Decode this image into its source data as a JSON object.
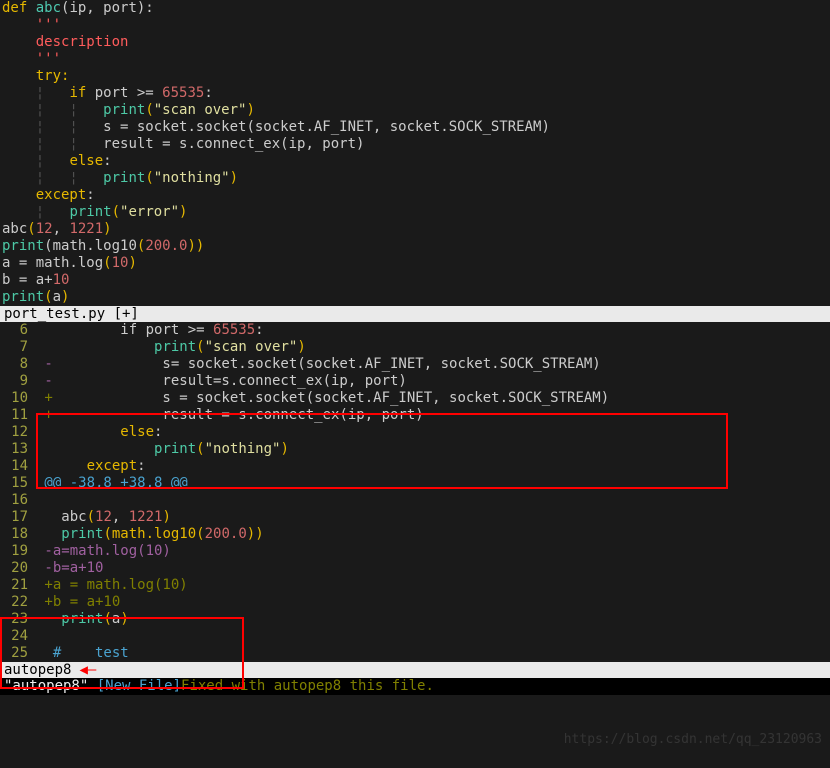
{
  "top": {
    "l1": {
      "def": "def ",
      "name": "abc",
      "args": "(ip, port):"
    },
    "l2": "    '''",
    "l3": "    description",
    "l4": "    '''",
    "l5": {
      "try": "    try:"
    },
    "l6": {
      "g": "    ¦   ",
      "if": "if ",
      "cond": "port >= ",
      "num": "65535",
      ":": ":"
    },
    "l7": {
      "g": "    ¦   ¦   ",
      "p": "print",
      "o": "(",
      "s": "\"scan over\"",
      "c": ")"
    },
    "l8": {
      "g": "    ¦   ¦   ",
      "code": "s = socket.socket(socket.AF_INET, socket.SOCK_STREAM)"
    },
    "l9": {
      "g": "    ¦   ¦   ",
      "code": "result = s.connect_ex(ip, port)"
    },
    "l10": {
      "g": "    ¦   ",
      "else": "else",
      ":": ":"
    },
    "l11": {
      "g": "    ¦   ¦   ",
      "p": "print",
      "o": "(",
      "s": "\"nothing\"",
      "c": ")"
    },
    "l12": {
      "except": "    except",
      ":": ":"
    },
    "l13": {
      "g": "    ¦   ",
      "p": "print",
      "o": "(",
      "s": "\"error\"",
      "c": ")"
    },
    "l14": "",
    "l15": "",
    "l16": {
      "fn": "abc",
      "o": "(",
      "a": "12",
      ",": ", ",
      "b": "1221",
      "c": ")"
    },
    "l17": {
      "p": "print",
      "o": "(math.log10",
      "paren": "(",
      "n": "200.0",
      "c": "))"
    },
    "l18": {
      "lhs": "a = math.log",
      "o": "(",
      "n": "10",
      "c": ")"
    },
    "l19": {
      "lhs": "b = a+",
      "n": "10"
    },
    "l20": {
      "p": "print",
      "o": "(",
      "a": "a",
      "c": ")"
    }
  },
  "status1": "port_test.py [+]",
  "bottom": {
    "lines": [
      {
        "num": "6",
        "text_pre": "         if",
        "text2": " port >= ",
        "num2": "65535",
        "colon": ":"
      },
      {
        "num": "7",
        "text_pre": "             ",
        "p": "print",
        "o": "(",
        "s": "\"scan over\"",
        "c": ")"
      },
      {
        "num": "8",
        "diff": "-",
        "text": "             s= socket.socket(socket.AF_INET, socket.SOCK_STREAM)"
      },
      {
        "num": "9",
        "diff": "-",
        "text": "             result=s.connect_ex(ip, port)"
      },
      {
        "num": "10",
        "diff": "+",
        "text": "             s = socket.socket(socket.AF_INET, socket.SOCK_STREAM)"
      },
      {
        "num": "11",
        "diff": "+",
        "text": "             result = s.connect_ex(ip, port)"
      },
      {
        "num": "12",
        "text_pre": "         ",
        "else": "else",
        ":": ":"
      },
      {
        "num": "13",
        "text_pre": "             ",
        "p": "print",
        "o": "(",
        "s": "\"nothing\"",
        "c": ")"
      },
      {
        "num": "14",
        "text_pre": "     ",
        "except": "except",
        ":": ":"
      },
      {
        "num": "15",
        "meta": " @@ -38,8 +38,8 @@"
      },
      {
        "num": "16",
        "blank": " "
      },
      {
        "num": "17",
        "text_pre": "  ",
        "fn": "abc",
        "o": "(",
        "a": "12",
        ",": ", ",
        "b": "1221",
        "c": ")"
      },
      {
        "num": "18",
        "text_pre": "  ",
        "p": "print",
        "o": "(math.log10",
        "paren": "(",
        "n": "200.0",
        "c": "))"
      },
      {
        "num": "19",
        "diff": "-",
        "dtext": "a=math.log(10)"
      },
      {
        "num": "20",
        "diff": "-",
        "dtext": "b=a+10"
      },
      {
        "num": "21",
        "diff": "+",
        "dtext": "a = math.log(10)"
      },
      {
        "num": "22",
        "diff": "+",
        "dtext": "b = a+10"
      },
      {
        "num": "23",
        "text_pre": "  ",
        "p": "print",
        "o": "(",
        "a": "a",
        "c": ")"
      },
      {
        "num": "24",
        "blank": " "
      },
      {
        "num": "25",
        "comment": "  #    test"
      }
    ]
  },
  "status2": "autopep8",
  "arrow": "◀—",
  "cmdline": {
    "q": "\"autopep8\" ",
    "fn": "[New File]",
    "msg": "Fixed with autopep8 this file."
  },
  "watermark": "https://blog.csdn.net/qq_23120963"
}
